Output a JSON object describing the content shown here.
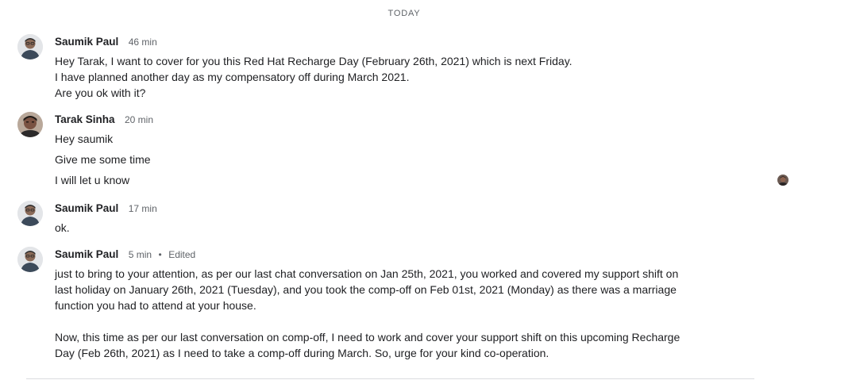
{
  "divider": {
    "label": "TODAY"
  },
  "messages": [
    {
      "sender": "Saumik Paul",
      "time": "46 min",
      "lines": [
        "Hey Tarak, I want to cover for you this Red Hat Recharge Day (February 26th, 2021) which is next Friday.",
        "I have planned another day as my compensatory off during March 2021.",
        "Are you ok with it?"
      ]
    },
    {
      "sender": "Tarak Sinha",
      "time": "20 min",
      "lines": [
        "Hey saumik",
        "Give me some time",
        "I will let u know"
      ]
    },
    {
      "sender": "Saumik Paul",
      "time": "17 min",
      "lines": [
        "ok."
      ]
    },
    {
      "sender": "Saumik Paul",
      "time": "5 min",
      "edited_separator": "•",
      "edited": "Edited",
      "lines": [
        "just to bring to your attention, as per our last chat conversation on Jan 25th, 2021, you worked and covered my support shift on",
        "last holiday on January 26th, 2021 (Tuesday), and you took the comp-off on Feb 01st, 2021 (Monday) as there was a marriage",
        "function you had to attend at your house.",
        "",
        "Now, this time as per our last conversation on comp-off, I need to work and cover your support shift on this upcoming Recharge",
        "Day (Feb 26th, 2021) as I need to take a comp-off during March. So, urge for your kind co-operation."
      ]
    }
  ],
  "icons": {
    "saumik_avatar": "person-avatar-icon",
    "tarak_avatar": "person-avatar-icon",
    "read_receipt": "read-receipt-avatar-icon"
  },
  "colors": {
    "text": "#202124",
    "meta": "#5f6368",
    "divider": "#dadce0"
  }
}
